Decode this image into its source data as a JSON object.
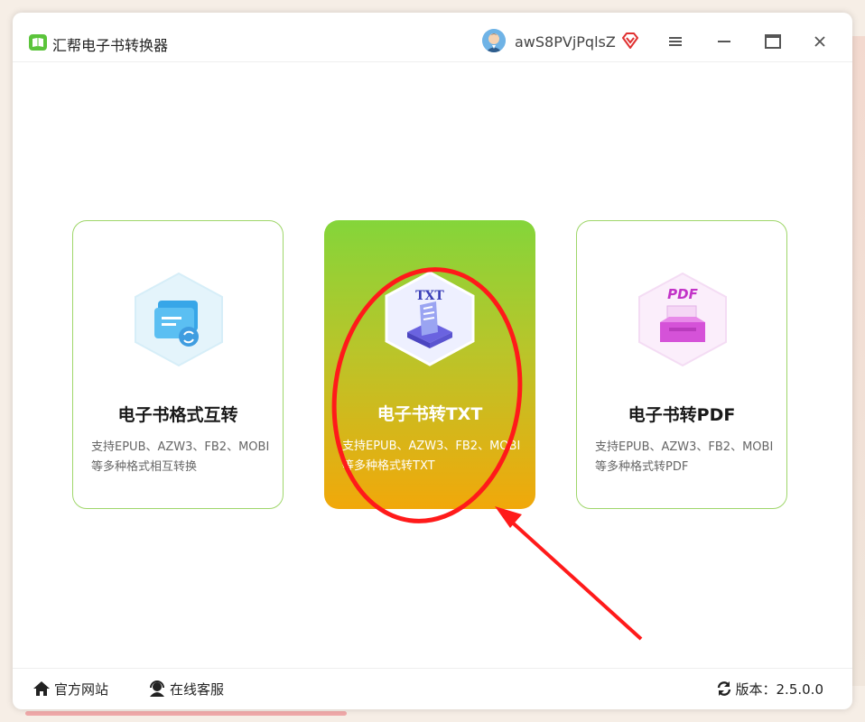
{
  "app": {
    "title": "汇帮电子书转换器",
    "username": "awS8PVjPqlsZ"
  },
  "icons": {
    "app_logo": "book-icon",
    "avatar": "user-avatar",
    "vip": "vip-diamond-icon",
    "menu": "hamburger-icon",
    "minimize": "minimize-icon",
    "maximize": "maximize-icon",
    "close": "close-icon",
    "home": "home-icon",
    "service": "headset-icon",
    "refresh": "refresh-icon"
  },
  "colors": {
    "accent_green": "#84d53a",
    "accent_orange": "#f1a80a",
    "card_border": "#9fd66a",
    "annotation_red": "#ff1a1a"
  },
  "cards": [
    {
      "title": "电子书格式互转",
      "desc_line1": "支持EPUB、AZW3、FB2、MOBI",
      "desc_line2": "等多种格式相互转换",
      "active": false
    },
    {
      "title": "电子书转TXT",
      "icon_label": "TXT",
      "desc_line1": "支持EPUB、AZW3、FB2、MOBI",
      "desc_line2": "等多种格式转TXT",
      "active": true
    },
    {
      "title": "电子书转PDF",
      "icon_label": "PDF",
      "desc_line1": "支持EPUB、AZW3、FB2、MOBI",
      "desc_line2": "等多种格式转PDF",
      "active": false
    }
  ],
  "footer": {
    "website": "官方网站",
    "support": "在线客服",
    "version_label": "版本：",
    "version": "2.5.0.0"
  }
}
